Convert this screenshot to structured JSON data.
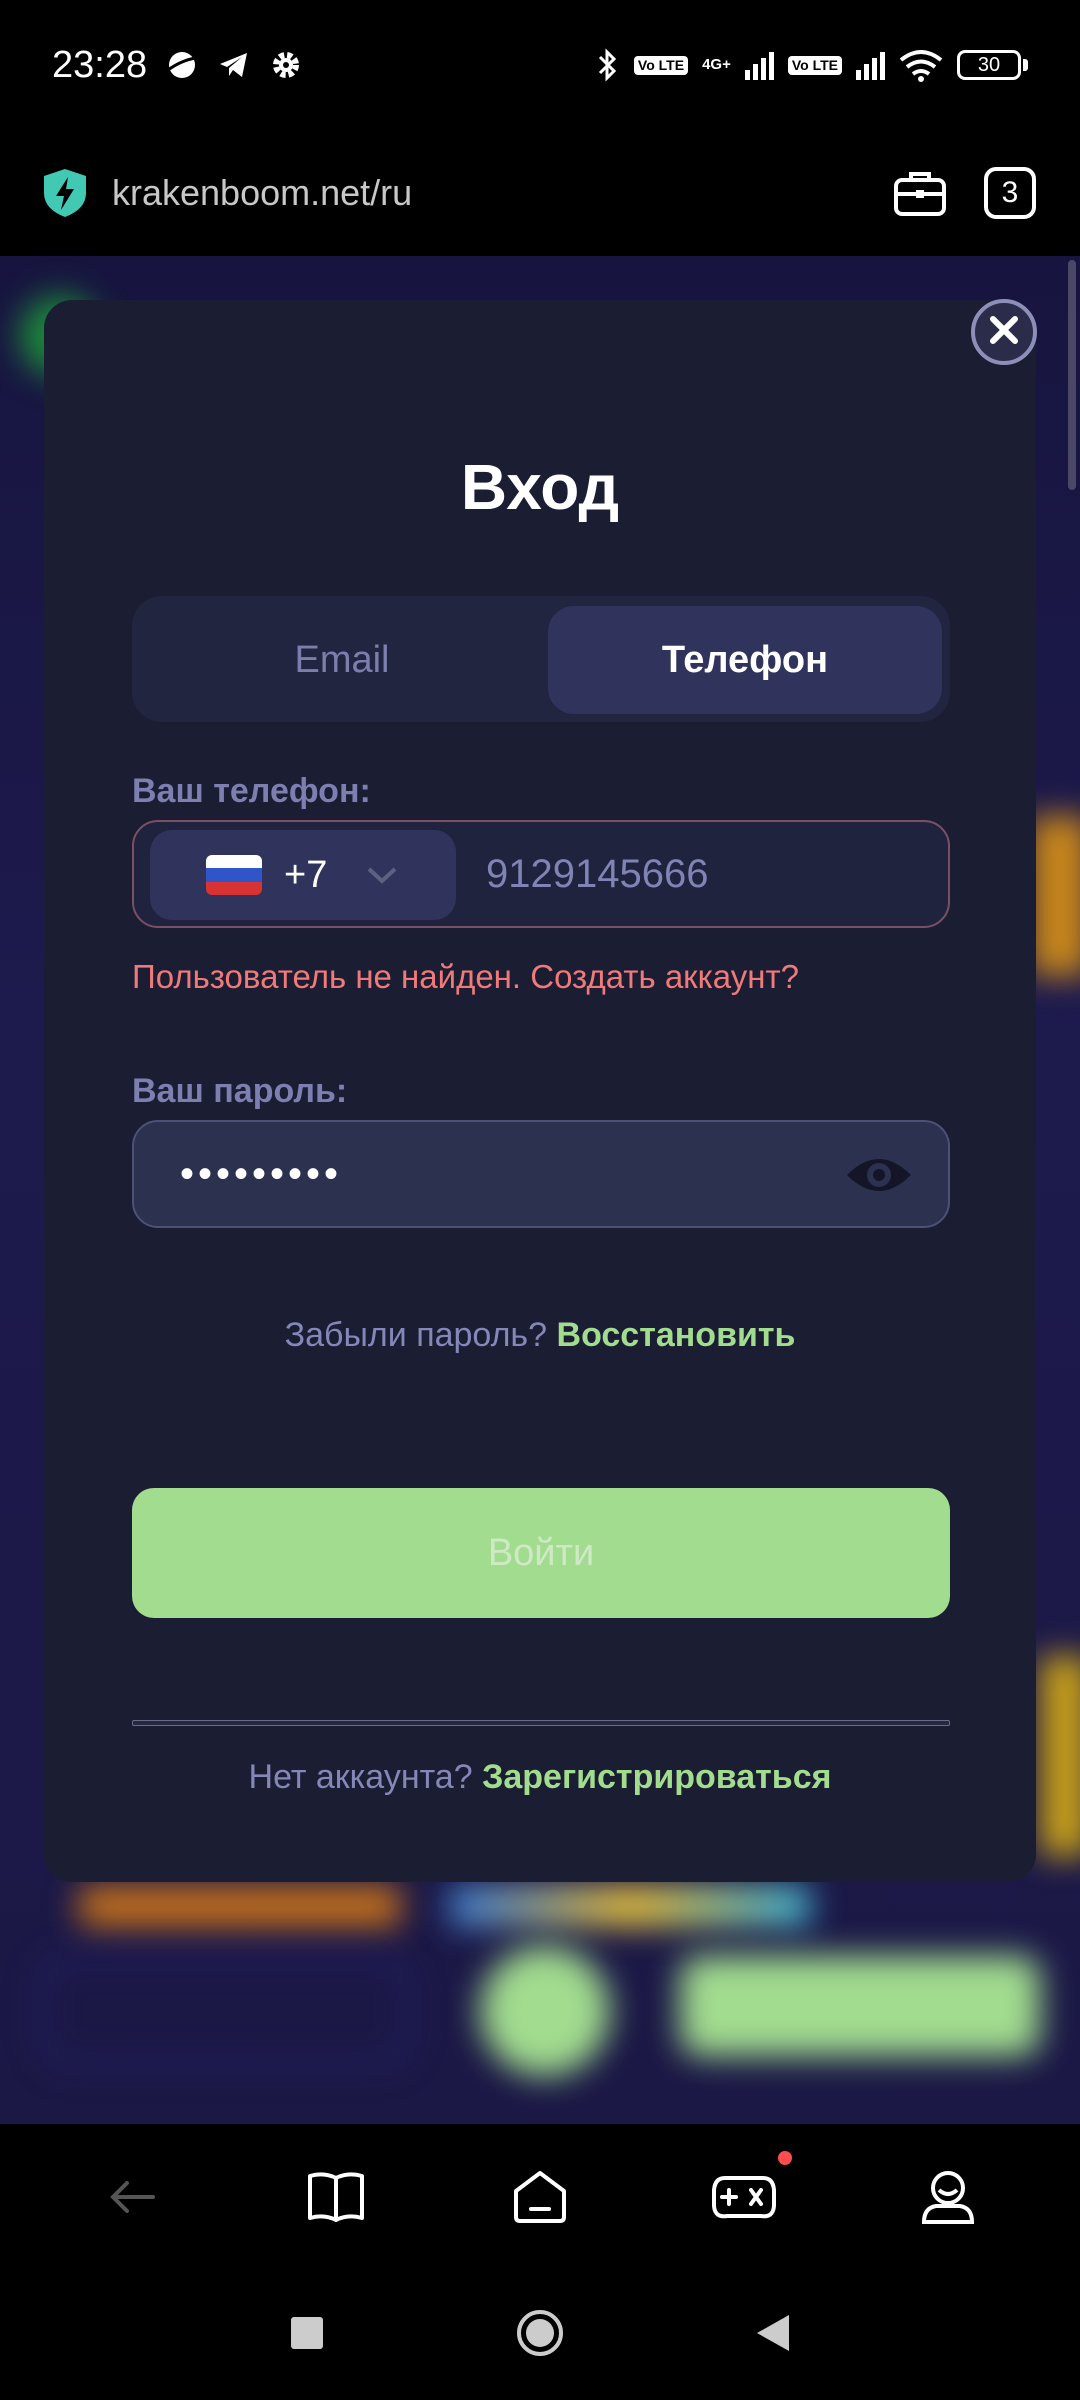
{
  "status_bar": {
    "time": "23:28",
    "battery": "30",
    "network": "4G+",
    "lte_label": "Vo LTE"
  },
  "browser": {
    "url": "krakenboom.net/ru",
    "tab_count": "3"
  },
  "modal": {
    "title": "Вход",
    "tabs": [
      {
        "label": "Email",
        "active": false
      },
      {
        "label": "Телефон",
        "active": true
      }
    ],
    "phone_label": "Ваш телефон:",
    "country_code": "+7",
    "phone_value": "9129145666",
    "error_text": "Пользователь не найден. Создать аккаунт?",
    "password_label": "Ваш пароль:",
    "password_value": "•••••••••",
    "forgot_text": "Забыли пароль?",
    "forgot_link": "Восстановить",
    "login_button": "Войти",
    "no_account_text": "Нет аккаунта?",
    "register_link": "Зарегистрироваться"
  },
  "colors": {
    "accent_green": "#a2dc8f",
    "error_red": "#f07a7a",
    "modal_bg": "#1b1d33"
  },
  "icons": {
    "url_shield": "shield-bolt-icon",
    "briefcase": "briefcase-icon",
    "close": "close-icon",
    "eye": "eye-icon",
    "nav": [
      "back-arrow-icon",
      "book-icon",
      "home-icon",
      "gamepad-icon",
      "profile-icon"
    ],
    "system": [
      "recents-square-icon",
      "home-circle-icon",
      "back-triangle-icon"
    ]
  }
}
